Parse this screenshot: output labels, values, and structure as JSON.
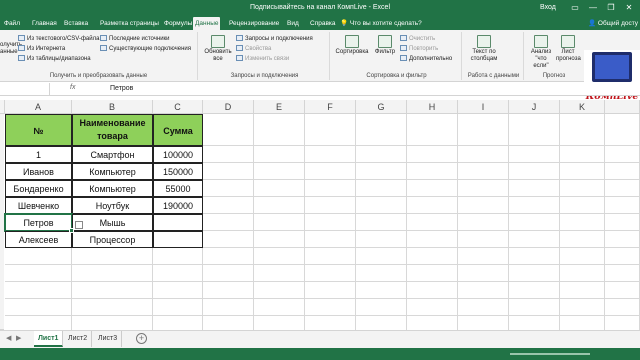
{
  "window": {
    "title": "Подписывайтесь на канал КомпLive  -  Excel",
    "login": "Вход",
    "min": "—",
    "restore": "❐",
    "close": "✕",
    "ribbon_collapse": "▭"
  },
  "ribbon_tabs": [
    "Файл",
    "Главная",
    "Вставка",
    "Разметка страницы",
    "Формулы",
    "Данные",
    "Рецензирование",
    "Вид",
    "Справка",
    "Что вы хотите сделать?"
  ],
  "active_tab": "Данные",
  "share": "Общий досту",
  "ribbon": {
    "get_data_group": {
      "items": [
        "Из текстового/CSV-файла",
        "Из Интернета",
        "Из таблицы/диапазона"
      ],
      "recent": [
        "Последние источники",
        "Существующие подключения"
      ],
      "big_btn": "олучить\nанные",
      "label": "Получить и преобразовать данные"
    },
    "queries_group": {
      "refresh": "Обновить все",
      "items": [
        "Запросы и подключения",
        "Свойства",
        "Изменить связи"
      ],
      "label": "Запросы и подключения"
    },
    "sort_group": {
      "sort": "Сортировка",
      "filter": "Фильтр",
      "items": [
        "Очистить",
        "Повторить",
        "Дополнительно"
      ],
      "label": "Сортировка и фильтр"
    },
    "data_tools_group": {
      "text_to_columns": "Текст по столбцам",
      "label": "Работа с данными"
    },
    "forecast_group": {
      "whatif": "Анализ \"что если\"",
      "sheet": "Лист прогноза",
      "label": "Прогноз"
    }
  },
  "logo_text": "КомпLive",
  "formula_bar": {
    "name_box": "",
    "fx": "fx",
    "content": "Петров"
  },
  "columns": [
    "A",
    "B",
    "C",
    "D",
    "E",
    "F",
    "G",
    "H",
    "I",
    "J",
    "K"
  ],
  "table": {
    "headers": [
      "№",
      "Наименование товара",
      "Сумма"
    ],
    "rows": [
      [
        "1",
        "Смартфон",
        "100000"
      ],
      [
        "Иванов",
        "Компьютер",
        "150000"
      ],
      [
        "Бондаренко",
        "Компьютер",
        "55000"
      ],
      [
        "Шевченко",
        "Ноутбук",
        "190000"
      ],
      [
        "Петров",
        "Мышь",
        ""
      ],
      [
        "Алексеев",
        "Процессор",
        ""
      ]
    ]
  },
  "sheets": [
    "Лист1",
    "Лист2",
    "Лист3"
  ],
  "active_sheet": "Лист1",
  "add_sheet": "+"
}
